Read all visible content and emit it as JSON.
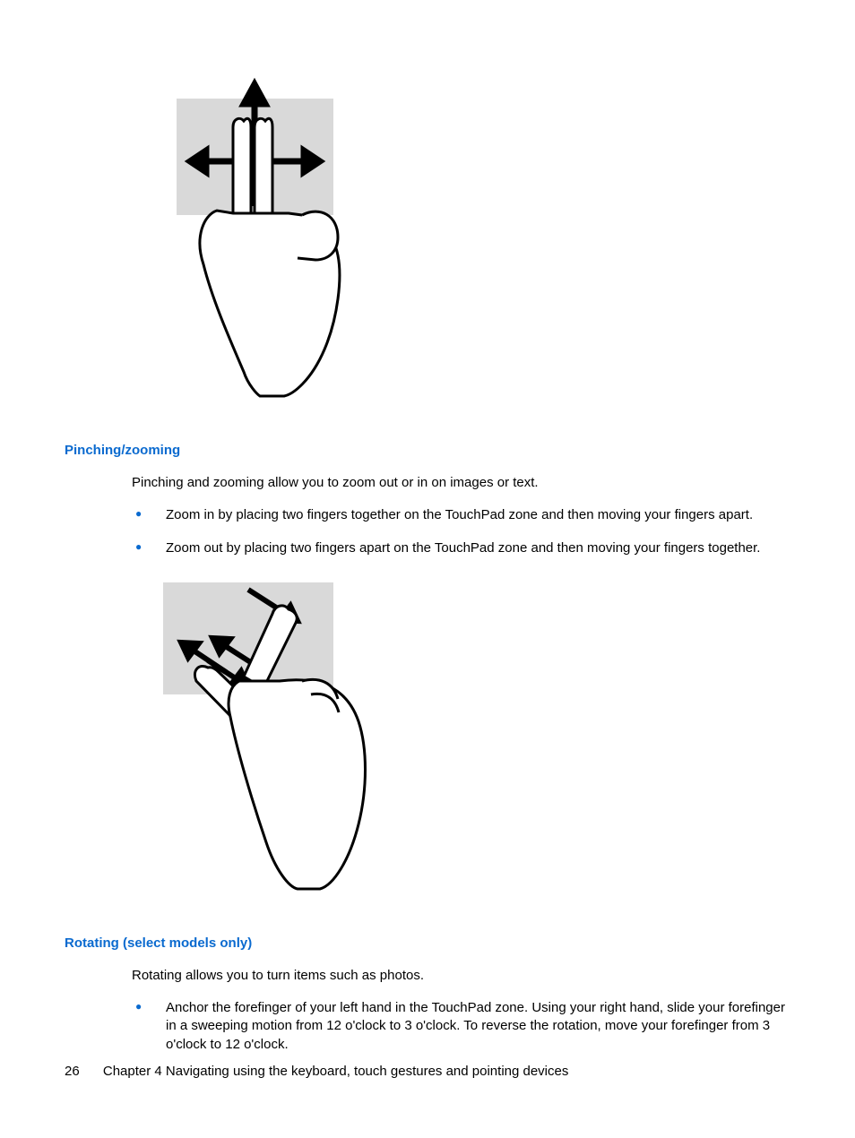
{
  "section1": {
    "heading": "Pinching/zooming",
    "intro": "Pinching and zooming allow you to zoom out or in on images or text.",
    "bullets": [
      "Zoom in by placing two fingers together on the TouchPad zone and then moving your fingers apart.",
      "Zoom out by placing two fingers apart on the TouchPad zone and then moving your fingers together."
    ]
  },
  "section2": {
    "heading": "Rotating (select models only)",
    "intro": "Rotating allows you to turn items such as photos.",
    "bullets": [
      "Anchor the forefinger of your left hand in the TouchPad zone. Using your right hand, slide your forefinger in a sweeping motion from 12 o'clock to 3 o'clock. To reverse the rotation, move your forefinger from 3 o'clock to 12 o'clock."
    ]
  },
  "footer": {
    "page_number": "26",
    "chapter": "Chapter 4   Navigating using the keyboard, touch gestures and pointing devices"
  }
}
